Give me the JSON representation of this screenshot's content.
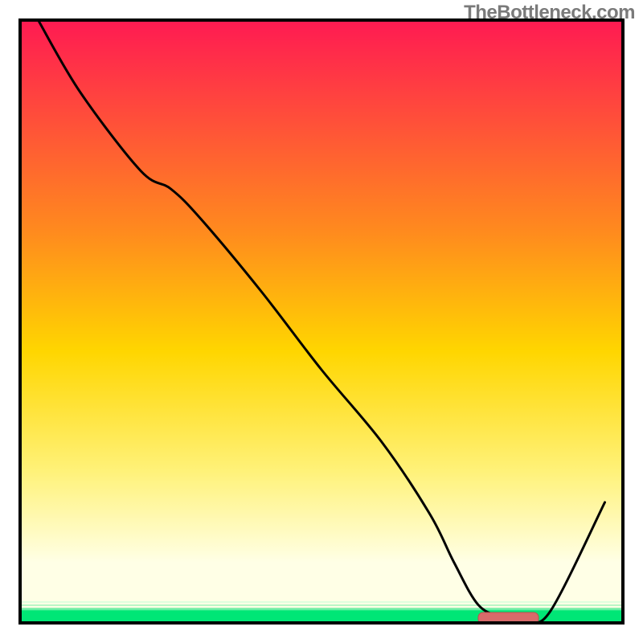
{
  "watermark": "TheBottleneck.com",
  "colors": {
    "bg_top": "#ff1a52",
    "bg_mid_upper": "#ff8a1e",
    "bg_mid": "#ffd600",
    "bg_mid_lower": "#fff27a",
    "bg_pale": "#ffffe6",
    "bg_green": "#00e676",
    "frame": "#000000",
    "curve": "#000000",
    "marker_fill": "#d86a6a",
    "marker_stroke": "#c05050"
  },
  "chart_data": {
    "type": "line",
    "title": "",
    "xlabel": "",
    "ylabel": "",
    "xlim": [
      0,
      100
    ],
    "ylim": [
      0,
      100
    ],
    "x": [
      3,
      10,
      20,
      25,
      30,
      40,
      50,
      60,
      68,
      72,
      76,
      80,
      84,
      88,
      97
    ],
    "values": [
      100,
      88,
      75,
      72,
      67,
      55,
      42,
      30,
      18,
      10,
      3,
      1,
      0.5,
      2,
      20
    ],
    "optimal_range_x": [
      76,
      86
    ],
    "optimal_y": 0.8
  }
}
